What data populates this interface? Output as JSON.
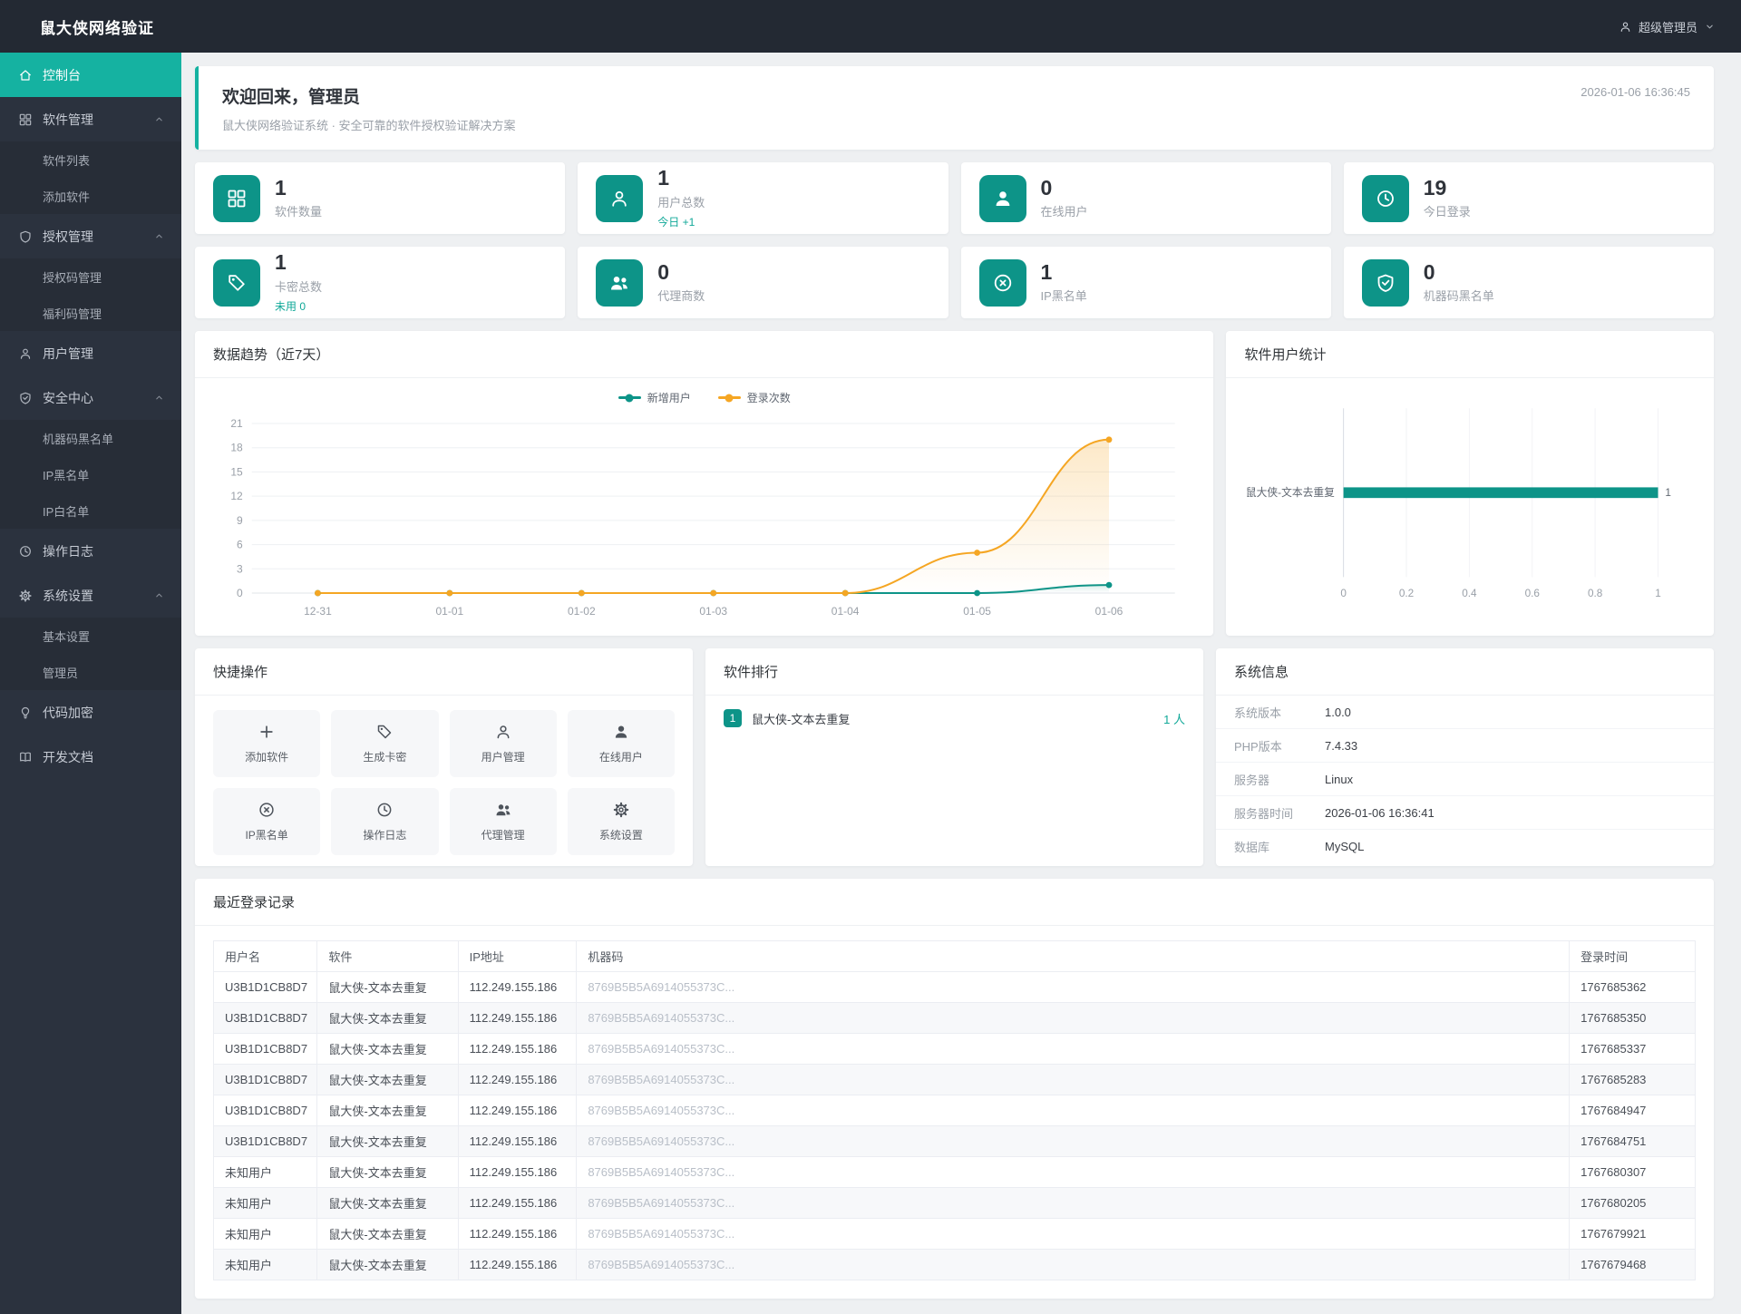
{
  "app": {
    "title": "鼠大侠网络验证"
  },
  "header": {
    "user_label": "超级管理员",
    "user_icon": "user-icon",
    "chevron_icon": "chevron-down-icon"
  },
  "sidebar": {
    "items": [
      {
        "label": "控制台",
        "icon": "home-icon"
      },
      {
        "label": "软件管理",
        "icon": "grid-icon"
      },
      {
        "label": "软件列表"
      },
      {
        "label": "添加软件"
      },
      {
        "label": "授权管理",
        "icon": "shield-icon"
      },
      {
        "label": "授权码管理"
      },
      {
        "label": "福利码管理"
      },
      {
        "label": "用户管理",
        "icon": "user-icon"
      },
      {
        "label": "安全中心",
        "icon": "shield-check-icon"
      },
      {
        "label": "机器码黑名单"
      },
      {
        "label": "IP黑名单"
      },
      {
        "label": "IP白名单"
      },
      {
        "label": "操作日志",
        "icon": "clock-icon"
      },
      {
        "label": "系统设置",
        "icon": "gear-icon"
      },
      {
        "label": "基本设置"
      },
      {
        "label": "管理员"
      },
      {
        "label": "代码加密",
        "icon": "bulb-icon"
      },
      {
        "label": "开发文档",
        "icon": "book-icon"
      }
    ]
  },
  "welcome": {
    "title": "欢迎回来，管理员",
    "subtitle": "鼠大侠网络验证系统 · 安全可靠的软件授权验证解决方案",
    "time": "2026-01-06 16:36:45"
  },
  "stats": [
    {
      "value": "1",
      "label": "软件数量",
      "icon": "grid-icon"
    },
    {
      "value": "1",
      "label": "用户总数",
      "note": "今日 +1",
      "icon": "user-icon"
    },
    {
      "value": "0",
      "label": "在线用户",
      "icon": "user-filled-icon"
    },
    {
      "value": "19",
      "label": "今日登录",
      "icon": "clock-icon"
    },
    {
      "value": "1",
      "label": "卡密总数",
      "note": "未用 0",
      "icon": "tag-icon"
    },
    {
      "value": "0",
      "label": "代理商数",
      "icon": "users-icon"
    },
    {
      "value": "1",
      "label": "IP黑名单",
      "icon": "ban-icon"
    },
    {
      "value": "0",
      "label": "机器码黑名单",
      "icon": "shield-check-icon"
    }
  ],
  "chart_data": [
    {
      "type": "line",
      "title": "数据趋势（近7天）",
      "x": [
        "12-31",
        "01-01",
        "01-02",
        "01-03",
        "01-04",
        "01-05",
        "01-06"
      ],
      "series": [
        {
          "name": "新增用户",
          "color": "#0d9488",
          "values": [
            0,
            0,
            0,
            0,
            0,
            0,
            1
          ]
        },
        {
          "name": "登录次数",
          "color": "#f5a623",
          "values": [
            0,
            0,
            0,
            0,
            0,
            5,
            19
          ]
        }
      ],
      "ylim": [
        0,
        21
      ],
      "yticks": [
        0,
        3,
        6,
        9,
        12,
        15,
        18,
        21
      ],
      "legend_position": "top",
      "grid": true
    },
    {
      "type": "bar",
      "orientation": "horizontal",
      "title": "软件用户统计",
      "categories": [
        "鼠大侠-文本去重复"
      ],
      "values": [
        1
      ],
      "value_labels": [
        "1"
      ],
      "xlim": [
        0,
        1
      ],
      "xticks": [
        "0",
        "0.2",
        "0.4",
        "0.6",
        "0.8",
        "1"
      ],
      "color": "#0d9488"
    }
  ],
  "quick_actions": {
    "title": "快捷操作",
    "items": [
      {
        "label": "添加软件",
        "icon": "plus-icon"
      },
      {
        "label": "生成卡密",
        "icon": "tag-icon"
      },
      {
        "label": "用户管理",
        "icon": "user-icon"
      },
      {
        "label": "在线用户",
        "icon": "user-filled-icon"
      },
      {
        "label": "IP黑名单",
        "icon": "ban-icon"
      },
      {
        "label": "操作日志",
        "icon": "clock-icon"
      },
      {
        "label": "代理管理",
        "icon": "users-icon"
      },
      {
        "label": "系统设置",
        "icon": "gear-icon"
      }
    ]
  },
  "ranking": {
    "title": "软件排行",
    "items": [
      {
        "rank": "1",
        "name": "鼠大侠-文本去重复",
        "count": "1 人"
      }
    ]
  },
  "system_info": {
    "title": "系统信息",
    "rows": [
      {
        "label": "系统版本",
        "value": "1.0.0"
      },
      {
        "label": "PHP版本",
        "value": "7.4.33"
      },
      {
        "label": "服务器",
        "value": "Linux"
      },
      {
        "label": "服务器时间",
        "value": "2026-01-06 16:36:41"
      },
      {
        "label": "数据库",
        "value": "MySQL"
      }
    ]
  },
  "logins": {
    "title": "最近登录记录",
    "columns": [
      "用户名",
      "软件",
      "IP地址",
      "机器码",
      "登录时间"
    ],
    "rows": [
      {
        "user": "U3B1D1CB8D7",
        "software": "鼠大侠-文本去重复",
        "ip": "112.249.155.186",
        "machine": "8769B5B5A6914055373C...",
        "time": "1767685362"
      },
      {
        "user": "U3B1D1CB8D7",
        "software": "鼠大侠-文本去重复",
        "ip": "112.249.155.186",
        "machine": "8769B5B5A6914055373C...",
        "time": "1767685350"
      },
      {
        "user": "U3B1D1CB8D7",
        "software": "鼠大侠-文本去重复",
        "ip": "112.249.155.186",
        "machine": "8769B5B5A6914055373C...",
        "time": "1767685337"
      },
      {
        "user": "U3B1D1CB8D7",
        "software": "鼠大侠-文本去重复",
        "ip": "112.249.155.186",
        "machine": "8769B5B5A6914055373C...",
        "time": "1767685283"
      },
      {
        "user": "U3B1D1CB8D7",
        "software": "鼠大侠-文本去重复",
        "ip": "112.249.155.186",
        "machine": "8769B5B5A6914055373C...",
        "time": "1767684947"
      },
      {
        "user": "U3B1D1CB8D7",
        "software": "鼠大侠-文本去重复",
        "ip": "112.249.155.186",
        "machine": "8769B5B5A6914055373C...",
        "time": "1767684751"
      },
      {
        "user": "未知用户",
        "software": "鼠大侠-文本去重复",
        "ip": "112.249.155.186",
        "machine": "8769B5B5A6914055373C...",
        "time": "1767680307"
      },
      {
        "user": "未知用户",
        "software": "鼠大侠-文本去重复",
        "ip": "112.249.155.186",
        "machine": "8769B5B5A6914055373C...",
        "time": "1767680205"
      },
      {
        "user": "未知用户",
        "software": "鼠大侠-文本去重复",
        "ip": "112.249.155.186",
        "machine": "8769B5B5A6914055373C...",
        "time": "1767679921"
      },
      {
        "user": "未知用户",
        "software": "鼠大侠-文本去重复",
        "ip": "112.249.155.186",
        "machine": "8769B5B5A6914055373C...",
        "time": "1767679468"
      }
    ]
  }
}
